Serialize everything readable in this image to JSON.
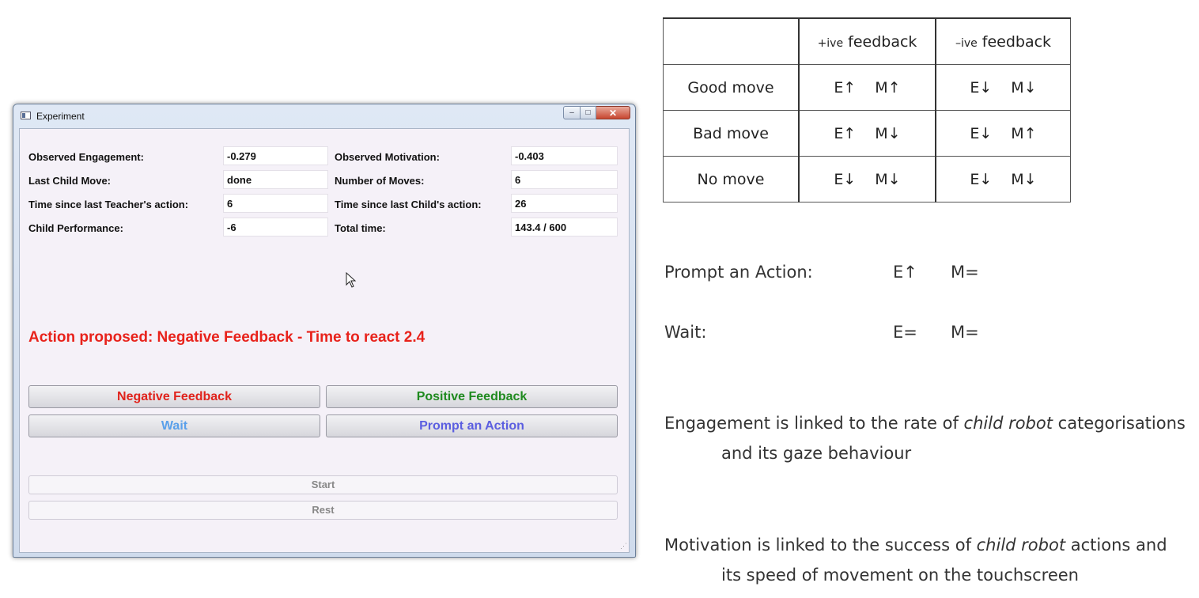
{
  "window": {
    "title": "Experiment",
    "controls": {
      "minimize": "–",
      "maximize": "□",
      "close": "✕"
    }
  },
  "fields": [
    {
      "label": "Observed Engagement:",
      "value": "-0.279"
    },
    {
      "label": "Observed Motivation:",
      "value": "-0.403"
    },
    {
      "label": "Last Child Move:",
      "value": "done"
    },
    {
      "label": "Number of Moves:",
      "value": "6"
    },
    {
      "label": "Time since last Teacher's action:",
      "value": "6"
    },
    {
      "label": "Time since last Child's action:",
      "value": "26"
    },
    {
      "label": "Child Performance:",
      "value": "-6"
    },
    {
      "label": "Total time:",
      "value": "143.4 / 600"
    }
  ],
  "proposal": "Action proposed: Negative Feedback - Time to react 2.4",
  "buttons": {
    "negative": "Negative Feedback",
    "positive": "Positive Feedback",
    "wait": "Wait",
    "prompt": "Prompt an Action",
    "start": "Start",
    "rest": "Rest"
  },
  "colors": {
    "proposal": "#e8221b",
    "negative": "#e0231c",
    "positive": "#1f8a1f",
    "wait": "#5aa0ea",
    "prompt": "#5b5ee0"
  },
  "table": {
    "header": [
      "",
      "+ive feedback",
      "–ive feedback"
    ],
    "header_signs": [
      "",
      "+ive",
      "–ive"
    ],
    "header_words": [
      "",
      "feedback",
      "feedback"
    ],
    "rows": [
      {
        "label": "Good move",
        "pos": [
          "E↑",
          "M↑"
        ],
        "neg": [
          "E↓",
          "M↓"
        ]
      },
      {
        "label": "Bad move",
        "pos": [
          "E↑",
          "M↓"
        ],
        "neg": [
          "E↓",
          "M↑"
        ]
      },
      {
        "label": "No move",
        "pos": [
          "E↓",
          "M↓"
        ],
        "neg": [
          "E↓",
          "M↓"
        ]
      }
    ]
  },
  "actions": [
    {
      "label": "Prompt an Action:",
      "e": "E↑",
      "m": "M="
    },
    {
      "label": "Wait:",
      "e": "E=",
      "m": "M="
    }
  ],
  "notes": {
    "engagement": {
      "line1_pre": "Engagement is linked to the rate of ",
      "line1_em": "child robot",
      "line1_post": " categorisations",
      "line2": "and its gaze behaviour"
    },
    "motivation": {
      "line1_pre": "Motivation is linked to the success of ",
      "line1_em": "child robot",
      "line1_post": " actions and",
      "line2": "its speed of movement on the touchscreen"
    }
  }
}
